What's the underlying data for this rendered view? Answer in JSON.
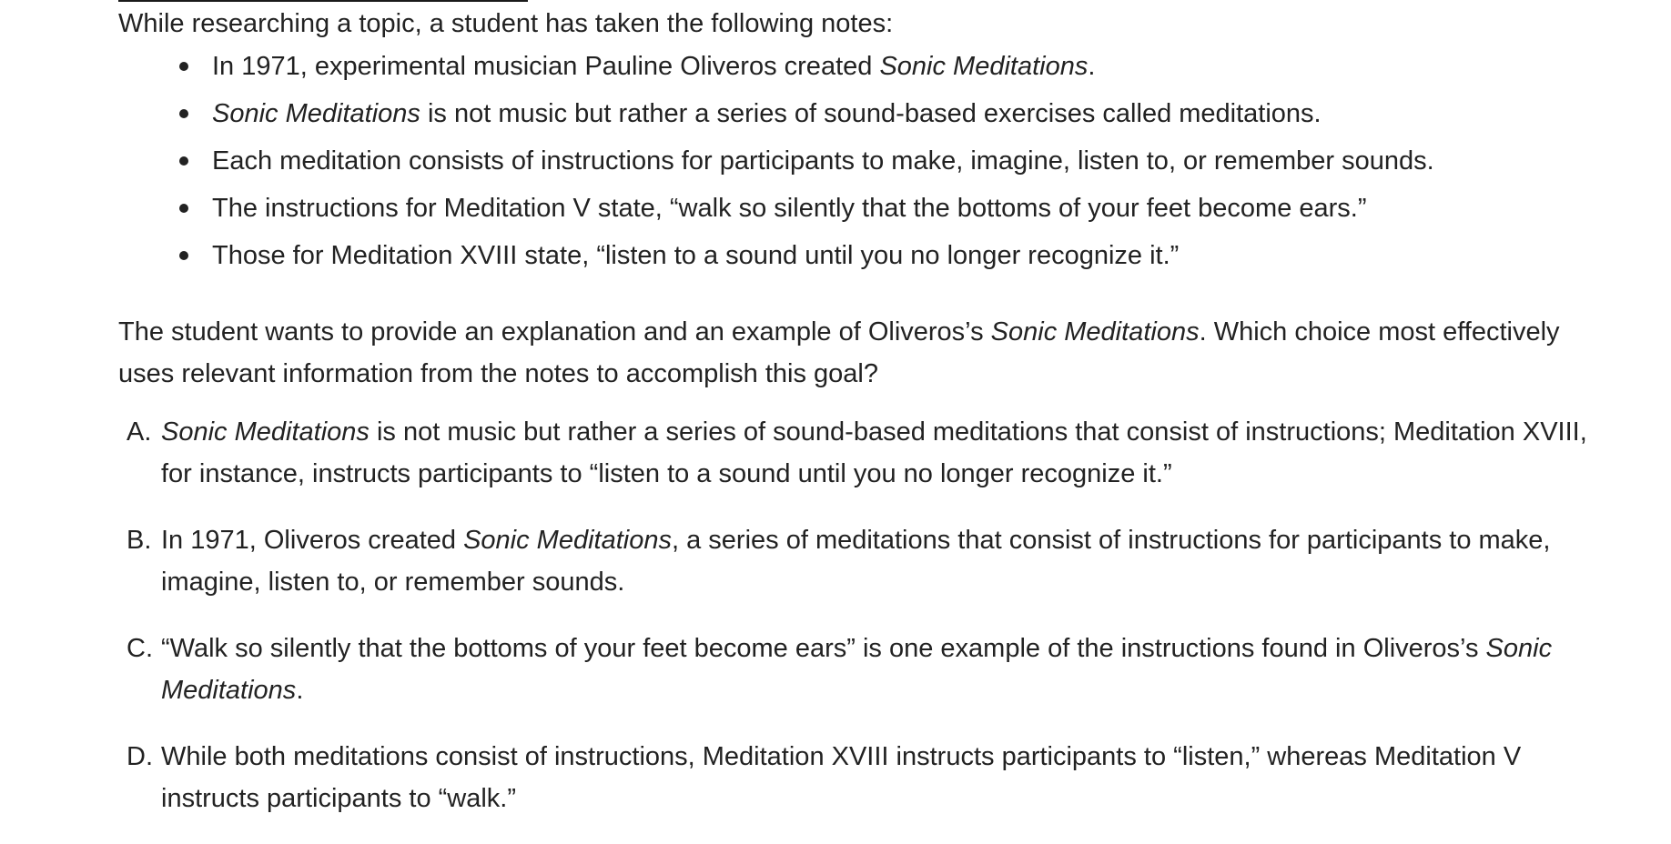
{
  "intro": "While researching a topic, a student has taken the following notes:",
  "notes": [
    {
      "before": "In 1971, experimental musician Pauline Oliveros created ",
      "italic": "Sonic Meditations",
      "after": "."
    },
    {
      "before": "",
      "italic": "Sonic Meditations",
      "after": " is not music but rather a series of sound-based exercises called meditations."
    },
    {
      "before": "Each meditation consists of instructions for participants to make, imagine, listen to, or remember sounds.",
      "italic": "",
      "after": ""
    },
    {
      "before": "The instructions for Meditation V state, “walk so silently that the bottoms of your feet become ears.”",
      "italic": "",
      "after": ""
    },
    {
      "before": "Those for Meditation XVIII state, “listen to a sound until you no longer recognize it.”",
      "italic": "",
      "after": ""
    }
  ],
  "prompt": {
    "before": "The student wants to provide an explanation and an example of Oliveros’s ",
    "italic": "Sonic Meditations",
    "after": ". Which choice most effectively uses relevant information from the notes to accomplish this goal?"
  },
  "choices": [
    {
      "letter": "A.",
      "before": "",
      "italic": "Sonic Meditations",
      "after": " is not music but rather a series of sound-based meditations that consist of instructions; Meditation XVIII, for instance, instructs participants to “listen to a sound until you no longer recognize it.”"
    },
    {
      "letter": "B.",
      "before": "In 1971, Oliveros created ",
      "italic": "Sonic Meditations",
      "after": ", a series of meditations that consist of instructions for participants to make, imagine, listen to, or remember sounds."
    },
    {
      "letter": "C.",
      "before": "“Walk so silently that the bottoms of your feet become ears” is one example of the instructions found in Oliveros’s ",
      "italic": "Sonic Meditations",
      "after": "."
    },
    {
      "letter": "D.",
      "before": "While both meditations consist of instructions, Meditation XVIII instructs participants to “listen,” whereas Meditation V instructs participants to “walk.”",
      "italic": "",
      "after": ""
    }
  ]
}
